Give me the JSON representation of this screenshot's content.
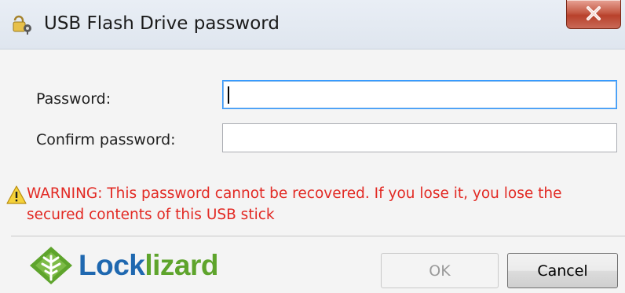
{
  "window": {
    "title": "USB Flash Drive password",
    "title_icon": "lock-key-icon",
    "close_icon": "close-icon"
  },
  "form": {
    "password_label": "Password:",
    "password_value": "",
    "confirm_label": "Confirm password:",
    "confirm_value": ""
  },
  "warning": {
    "icon": "warning-triangle-icon",
    "text": "WARNING: This password cannot be recovered.  If you lose it, you lose the secured contents of this USB stick",
    "color": "#e22a24"
  },
  "logo": {
    "part1": "Lock",
    "part2": "lizard",
    "color1": "#1f68b0",
    "color2": "#5ea42c"
  },
  "buttons": {
    "ok_label": "OK",
    "cancel_label": "Cancel"
  }
}
